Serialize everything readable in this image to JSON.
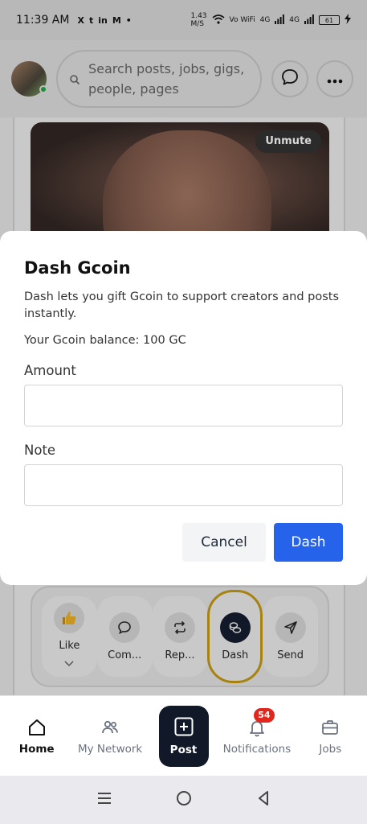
{
  "status_bar": {
    "time": "11:39 AM",
    "notification_icons": [
      "X",
      "t",
      "in",
      "M",
      "•"
    ],
    "net_speed": "1.43",
    "net_unit": "M/S",
    "volte": "Vo WiFi",
    "signal_1": "4G",
    "signal_2": "4G",
    "battery": "61"
  },
  "header": {
    "search_placeholder": "Search posts, jobs, gigs, people, pages"
  },
  "post": {
    "unmute_label": "Unmute"
  },
  "reactions": [
    {
      "label": "Like",
      "icon": "thumbs-up-icon"
    },
    {
      "label": "Com...",
      "icon": "comment-icon"
    },
    {
      "label": "Rep...",
      "icon": "repost-icon"
    },
    {
      "label": "Dash",
      "icon": "coins-icon"
    },
    {
      "label": "Send",
      "icon": "send-icon"
    }
  ],
  "modal": {
    "title": "Dash Gcoin",
    "description": "Dash lets you gift Gcoin to support creators and posts instantly.",
    "balance": "Your Gcoin balance: 100 GC",
    "amount_label": "Amount",
    "amount_value": "",
    "note_label": "Note",
    "note_value": "",
    "cancel_label": "Cancel",
    "dash_label": "Dash",
    "primary_color": "#2563eb"
  },
  "bottom_nav": {
    "items": [
      {
        "label": "Home",
        "icon": "home-icon",
        "active": true
      },
      {
        "label": "My Network",
        "icon": "people-icon"
      },
      {
        "label": "Post",
        "icon": "plus-square-icon"
      },
      {
        "label": "Notifications",
        "icon": "bell-icon",
        "badge": "54"
      },
      {
        "label": "Jobs",
        "icon": "briefcase-icon"
      }
    ]
  }
}
